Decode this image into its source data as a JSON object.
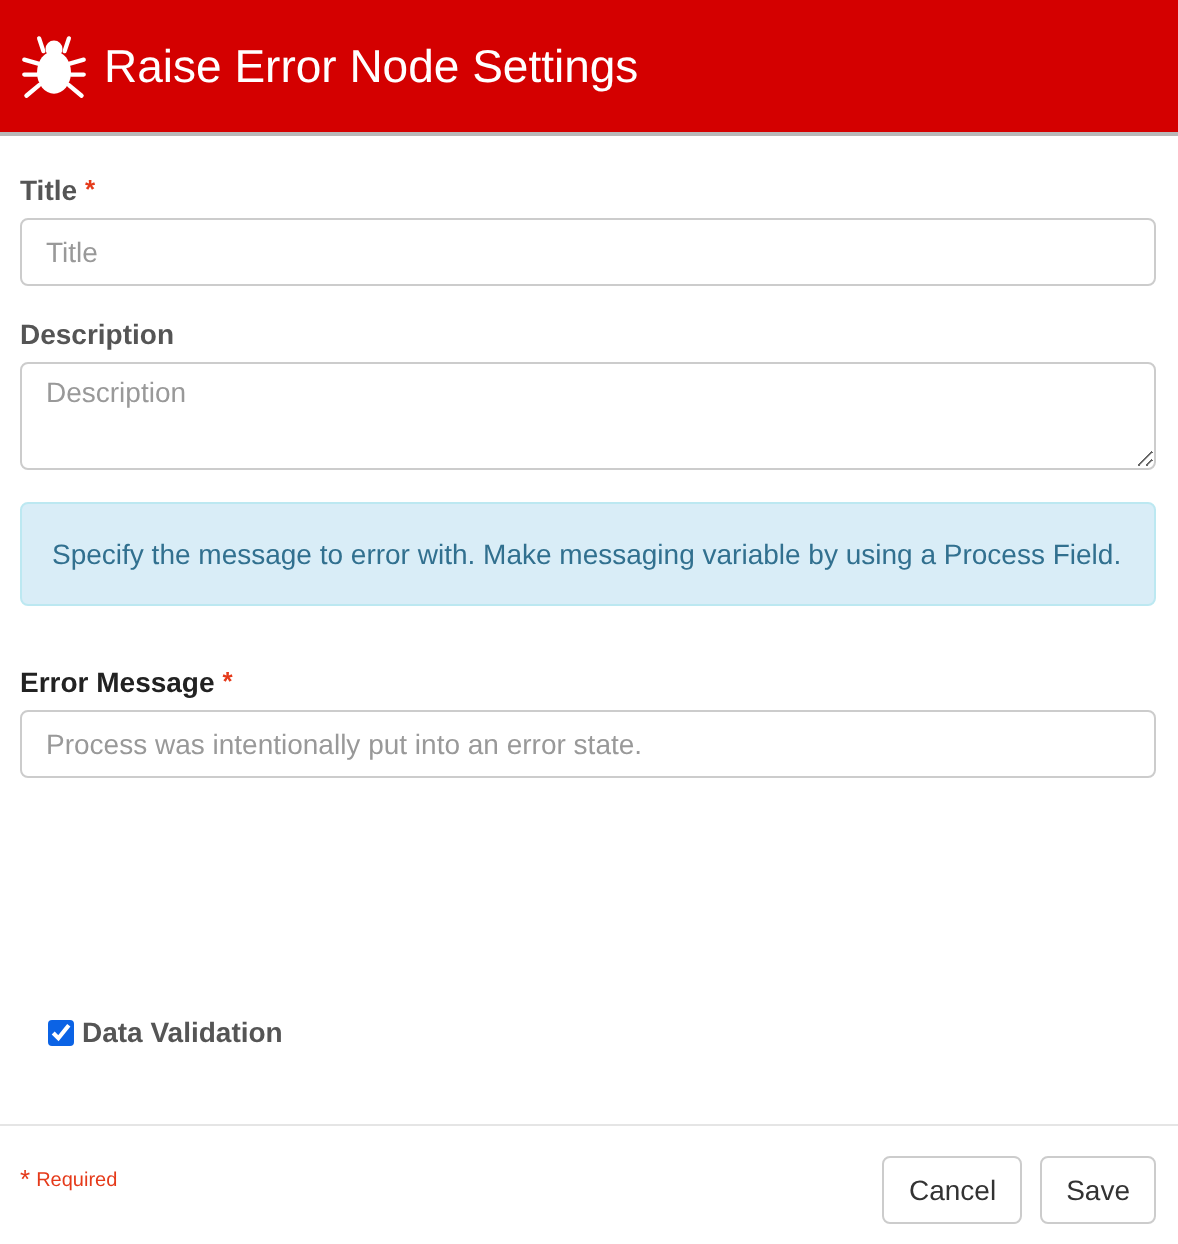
{
  "header": {
    "title": "Raise Error Node Settings"
  },
  "fields_top": [
    {
      "kind": "input",
      "label": "Title",
      "required_mark": "*",
      "placeholder": "Title"
    },
    {
      "kind": "textarea",
      "label": "Description",
      "placeholder": "Description"
    }
  ],
  "info": "Specify the message to error with. Make messaging variable by using a Process Field.",
  "fields_bottom": [
    {
      "kind": "input",
      "label": "Error Message",
      "required_mark": "*",
      "placeholder": "Process was intentionally put into an error state."
    }
  ],
  "checkbox": {
    "label": "Data Validation",
    "checked": true
  },
  "footer": {
    "required_mark": "*",
    "required_text": "Required",
    "buttons": [
      "Cancel",
      "Save"
    ]
  }
}
